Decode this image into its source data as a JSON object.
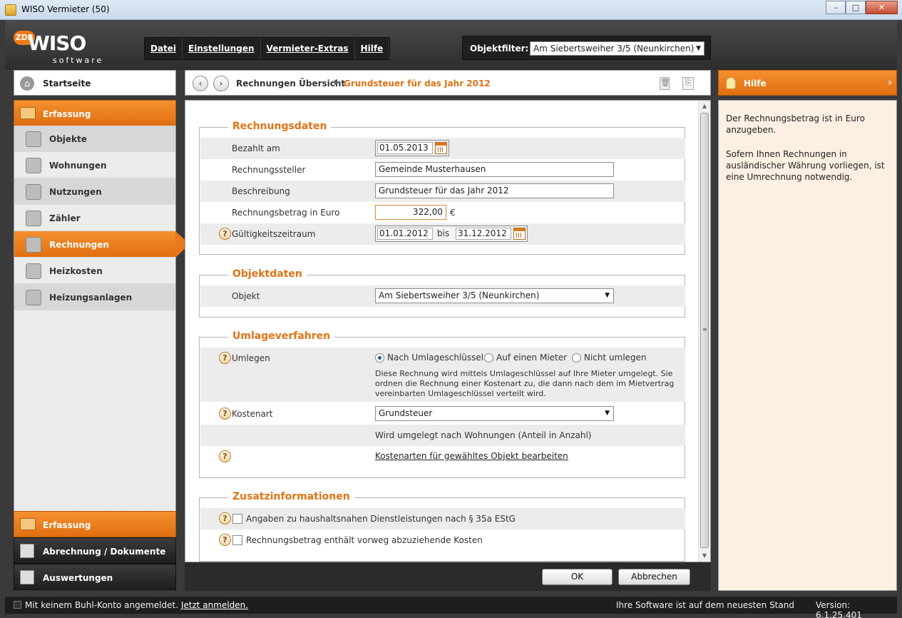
{
  "window": {
    "title": "WISO Vermieter (50)",
    "min": "–",
    "max": "□",
    "close": "✕"
  },
  "logo": {
    "badge": "ZDF",
    "brand": "WISO",
    "sub": "software"
  },
  "menu": {
    "items": [
      "Datei",
      "Einstellungen",
      "Vermieter-Extras",
      "Hilfe"
    ]
  },
  "objektfilter": {
    "label": "Objektfilter:",
    "value": "Am Siebertsweiher 3/5 (Neunkirchen)"
  },
  "sidebar": {
    "startseite": "Startseite",
    "section_top": "Erfassung",
    "items": [
      {
        "label": "Objekte",
        "icon": "building-icon"
      },
      {
        "label": "Wohnungen",
        "icon": "apartment-icon"
      },
      {
        "label": "Nutzungen",
        "icon": "users-icon"
      },
      {
        "label": "Zähler",
        "icon": "meter-icon"
      },
      {
        "label": "Rechnungen",
        "icon": "invoice-icon"
      },
      {
        "label": "Heizkosten",
        "icon": "heating-cost-icon"
      },
      {
        "label": "Heizungsanlagen",
        "icon": "heating-system-icon"
      }
    ],
    "active_index": 4,
    "bottom": [
      "Erfassung",
      "Abrechnung / Dokumente",
      "Auswertungen"
    ]
  },
  "breadcrumb": {
    "back": "‹",
    "forward": "›",
    "parent": "Rechnungen Übersicht",
    "current": "Grundsteuer für das Jahr 2012"
  },
  "rechnungsdaten": {
    "title": "Rechnungsdaten",
    "bezahlt_label": "Bezahlt am",
    "bezahlt_value": "01.05.2013",
    "steller_label": "Rechnungssteller",
    "steller_value": "Gemeinde Musterhausen",
    "beschreibung_label": "Beschreibung",
    "beschreibung_value": "Grundsteuer für das Jahr 2012",
    "betrag_label": "Rechnungsbetrag in Euro",
    "betrag_value": "322,00",
    "betrag_unit": "€",
    "zeitraum_label": "Gültigkeitszeitraum",
    "zeitraum_from": "01.01.2012",
    "zeitraum_bis": "bis",
    "zeitraum_to": "31.12.2012"
  },
  "objektdaten": {
    "title": "Objektdaten",
    "objekt_label": "Objekt",
    "objekt_value": "Am Siebertsweiher 3/5 (Neunkirchen)"
  },
  "umlage": {
    "title": "Umlageverfahren",
    "umlegen_label": "Umlegen",
    "options": [
      "Nach Umlageschlüssel",
      "Auf einen Mieter",
      "Nicht umlegen"
    ],
    "selected": 0,
    "desc1": "Diese Rechnung wird mittels Umlageschlüssel auf Ihre Mieter umgelegt. Sie",
    "desc2": "ordnen die Rechnung einer Kostenart zu, die dann nach dem im Mietvertrag",
    "desc3": "vereinbarten Umlageschlüssel verteilt wird.",
    "kostenart_label": "Kostenart",
    "kostenart_value": "Grundsteuer",
    "umlage_info": "Wird umgelegt nach Wohnungen (Anteil in Anzahl)",
    "link": "Kostenarten für gewähltes Objekt bearbeiten"
  },
  "zusatz": {
    "title": "Zusatzinformationen",
    "check1": "Angaben zu haushaltsnahen Dienstleistungen nach § 35a EStG",
    "check2": "Rechnungsbetrag enthält vorweg abzuziehende Kosten"
  },
  "help_q": "?",
  "actions": {
    "ok": "OK",
    "cancel": "Abbrechen"
  },
  "hilfe": {
    "title": "Hilfe",
    "p1": "Der Rechnungsbetrag ist in Euro anzugeben.",
    "p2": "Sofern Ihnen Rechnungen in ausländischer Währung vorliegen, ist eine Umrechnung notwendig."
  },
  "status": {
    "login_text": "Mit keinem Buhl-Konto angemeldet.",
    "login_link": "Jetzt anmelden.",
    "update": "Ihre Software ist auf dem neuesten Stand",
    "version": "Version: 6.1.25.401"
  }
}
